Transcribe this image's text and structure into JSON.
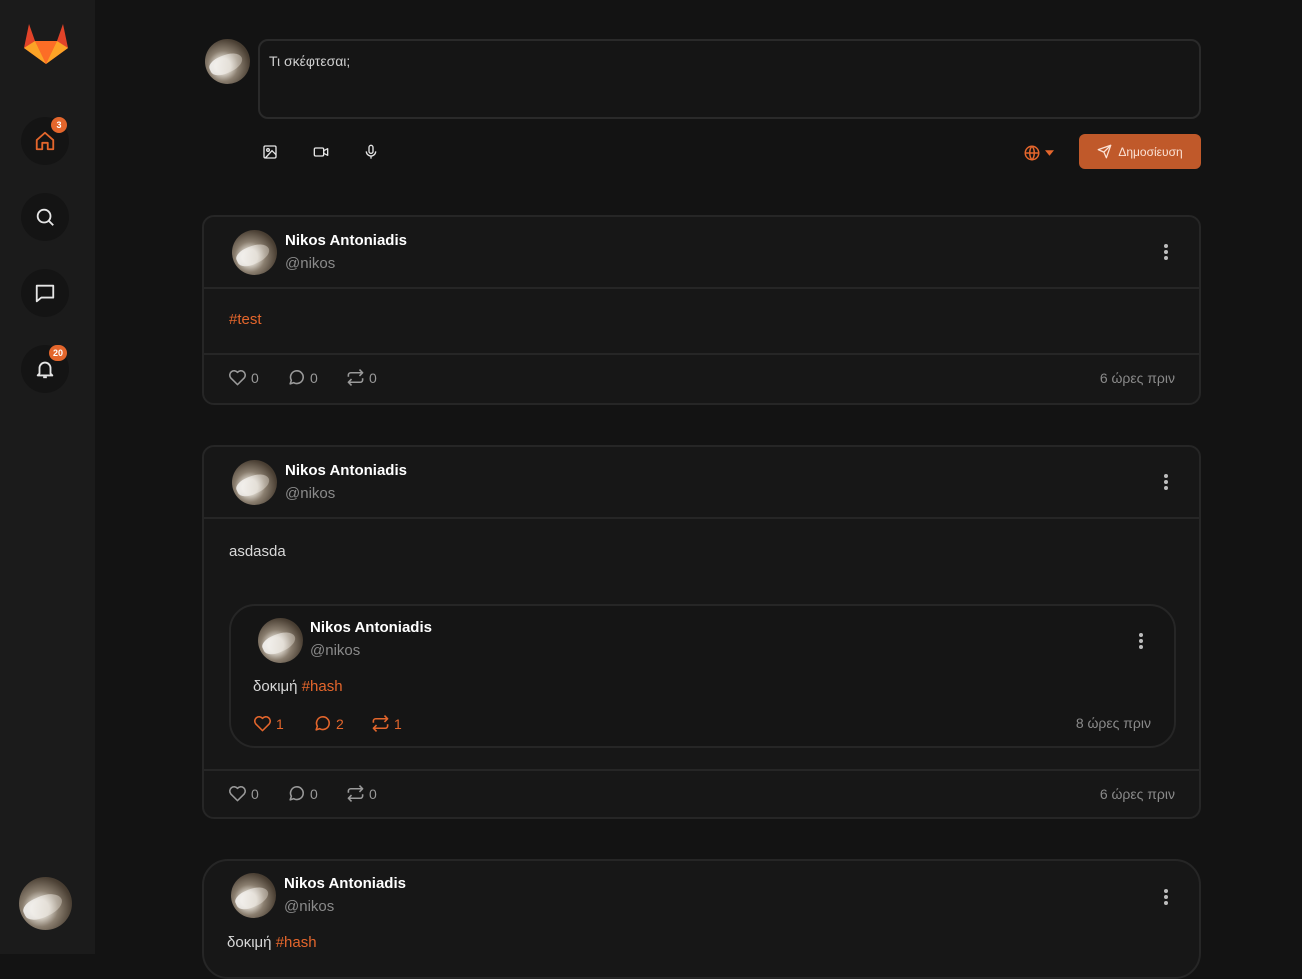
{
  "sidebar": {
    "home_badge": "3",
    "notifications_badge": "20"
  },
  "composer": {
    "placeholder": "Τι σκέφτεσαι;",
    "post_label": "Δημοσίευση"
  },
  "posts": [
    {
      "name": "Nikos Antoniadis",
      "handle": "@nikos",
      "text": "",
      "tag": "#test",
      "likes": "0",
      "comments": "0",
      "reposts": "0",
      "time": "6 ώρες πριν"
    },
    {
      "name": "Nikos Antoniadis",
      "handle": "@nikos",
      "text": "asdasda",
      "likes": "0",
      "comments": "0",
      "reposts": "0",
      "time": "6 ώρες πριν",
      "quote": {
        "name": "Nikos Antoniadis",
        "handle": "@nikos",
        "text": "δοκιμή",
        "tag": "#hash",
        "likes": "1",
        "comments": "2",
        "reposts": "1",
        "time": "8 ώρες πριν"
      }
    },
    {
      "name": "Nikos Antoniadis",
      "handle": "@nikos",
      "text": "δοκιμή",
      "tag": "#hash"
    }
  ],
  "colors": {
    "accent": "#e4662c",
    "background": "#131313",
    "sidebar": "#1b1b1b"
  }
}
